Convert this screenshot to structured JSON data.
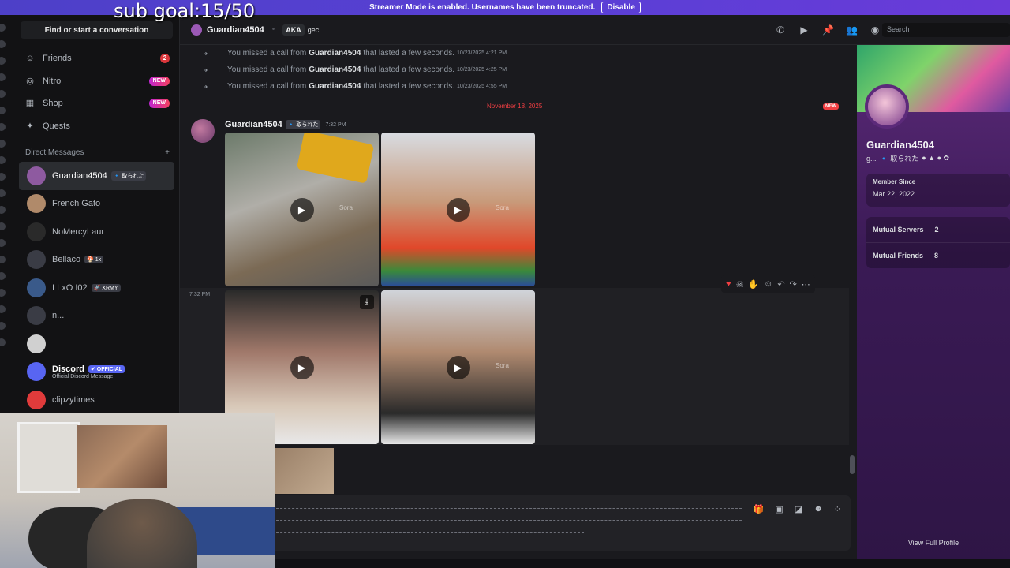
{
  "overlay": {
    "goal_text": "sub goal:15/50"
  },
  "banner": {
    "text": "Streamer Mode is enabled. Usernames have been truncated.",
    "button": "Disable"
  },
  "sidebar": {
    "search_label": "Find or start a conversation",
    "nav": [
      {
        "label": "Friends",
        "icon": "friends-icon",
        "badge": "2"
      },
      {
        "label": "Nitro",
        "icon": "nitro-icon",
        "badge": "NEW"
      },
      {
        "label": "Shop",
        "icon": "shop-icon",
        "badge": "NEW"
      },
      {
        "label": "Quests",
        "icon": "quests-icon",
        "badge": ""
      }
    ],
    "dm_header": "Direct Messages",
    "dm_add": "+",
    "dms": [
      {
        "name": "Guardian4504",
        "tag": "🔹 取られた",
        "active": true,
        "color": "#8e5aa0"
      },
      {
        "name": "French Gato",
        "tag": "",
        "color": "#b08a6a"
      },
      {
        "name": "NoMercyLaur",
        "tag": "",
        "color": "#2a2a2a"
      },
      {
        "name": "Bellaco",
        "tag": "🍄 1x",
        "color": "#3a3c45"
      },
      {
        "name": "I LxO I02",
        "tag": "🚀 XRMY",
        "color": "#3a5a8a"
      },
      {
        "name": "n...",
        "tag": "",
        "color": "#3a3c45"
      },
      {
        "name": "",
        "tag": "",
        "color": "#d0d0d0"
      },
      {
        "name": "Discord",
        "tag": "✔ OFFICIAL",
        "sub": "Official Discord Message",
        "color": "#5865f2"
      },
      {
        "name": "clipzytimes",
        "tag": "",
        "color": "#e03b3b"
      }
    ]
  },
  "header": {
    "name": "Guardian4504",
    "aka": "AKA",
    "nickname": "gec",
    "search_placeholder": "Search"
  },
  "chat": {
    "calls": [
      {
        "prefix": "You missed a call from",
        "user": "Guardian4504",
        "suffix": "that lasted a few seconds.",
        "time": "10/23/2025 4:21 PM"
      },
      {
        "prefix": "You missed a call from",
        "user": "Guardian4504",
        "suffix": "that lasted a few seconds.",
        "time": "10/23/2025 4:25 PM"
      },
      {
        "prefix": "You missed a call from",
        "user": "Guardian4504",
        "suffix": "that lasted a few seconds.",
        "time": "10/23/2025 4:55 PM"
      }
    ],
    "divider_date": "November 18, 2025",
    "divider_new": "NEW",
    "message": {
      "author": "Guardian4504",
      "tag": "🔹 取られた",
      "time": "7:32 PM"
    },
    "side_time": "7:32 PM",
    "watermark": "Sora"
  },
  "profile": {
    "display_name": "Guardian4504",
    "username": "g...",
    "tag": "🔹 取られた",
    "member_since_label": "Member Since",
    "member_since": "Mar 22, 2022",
    "mutual_servers": "Mutual Servers — 2",
    "mutual_friends": "Mutual Friends — 8",
    "view_full": "View Full Profile"
  }
}
